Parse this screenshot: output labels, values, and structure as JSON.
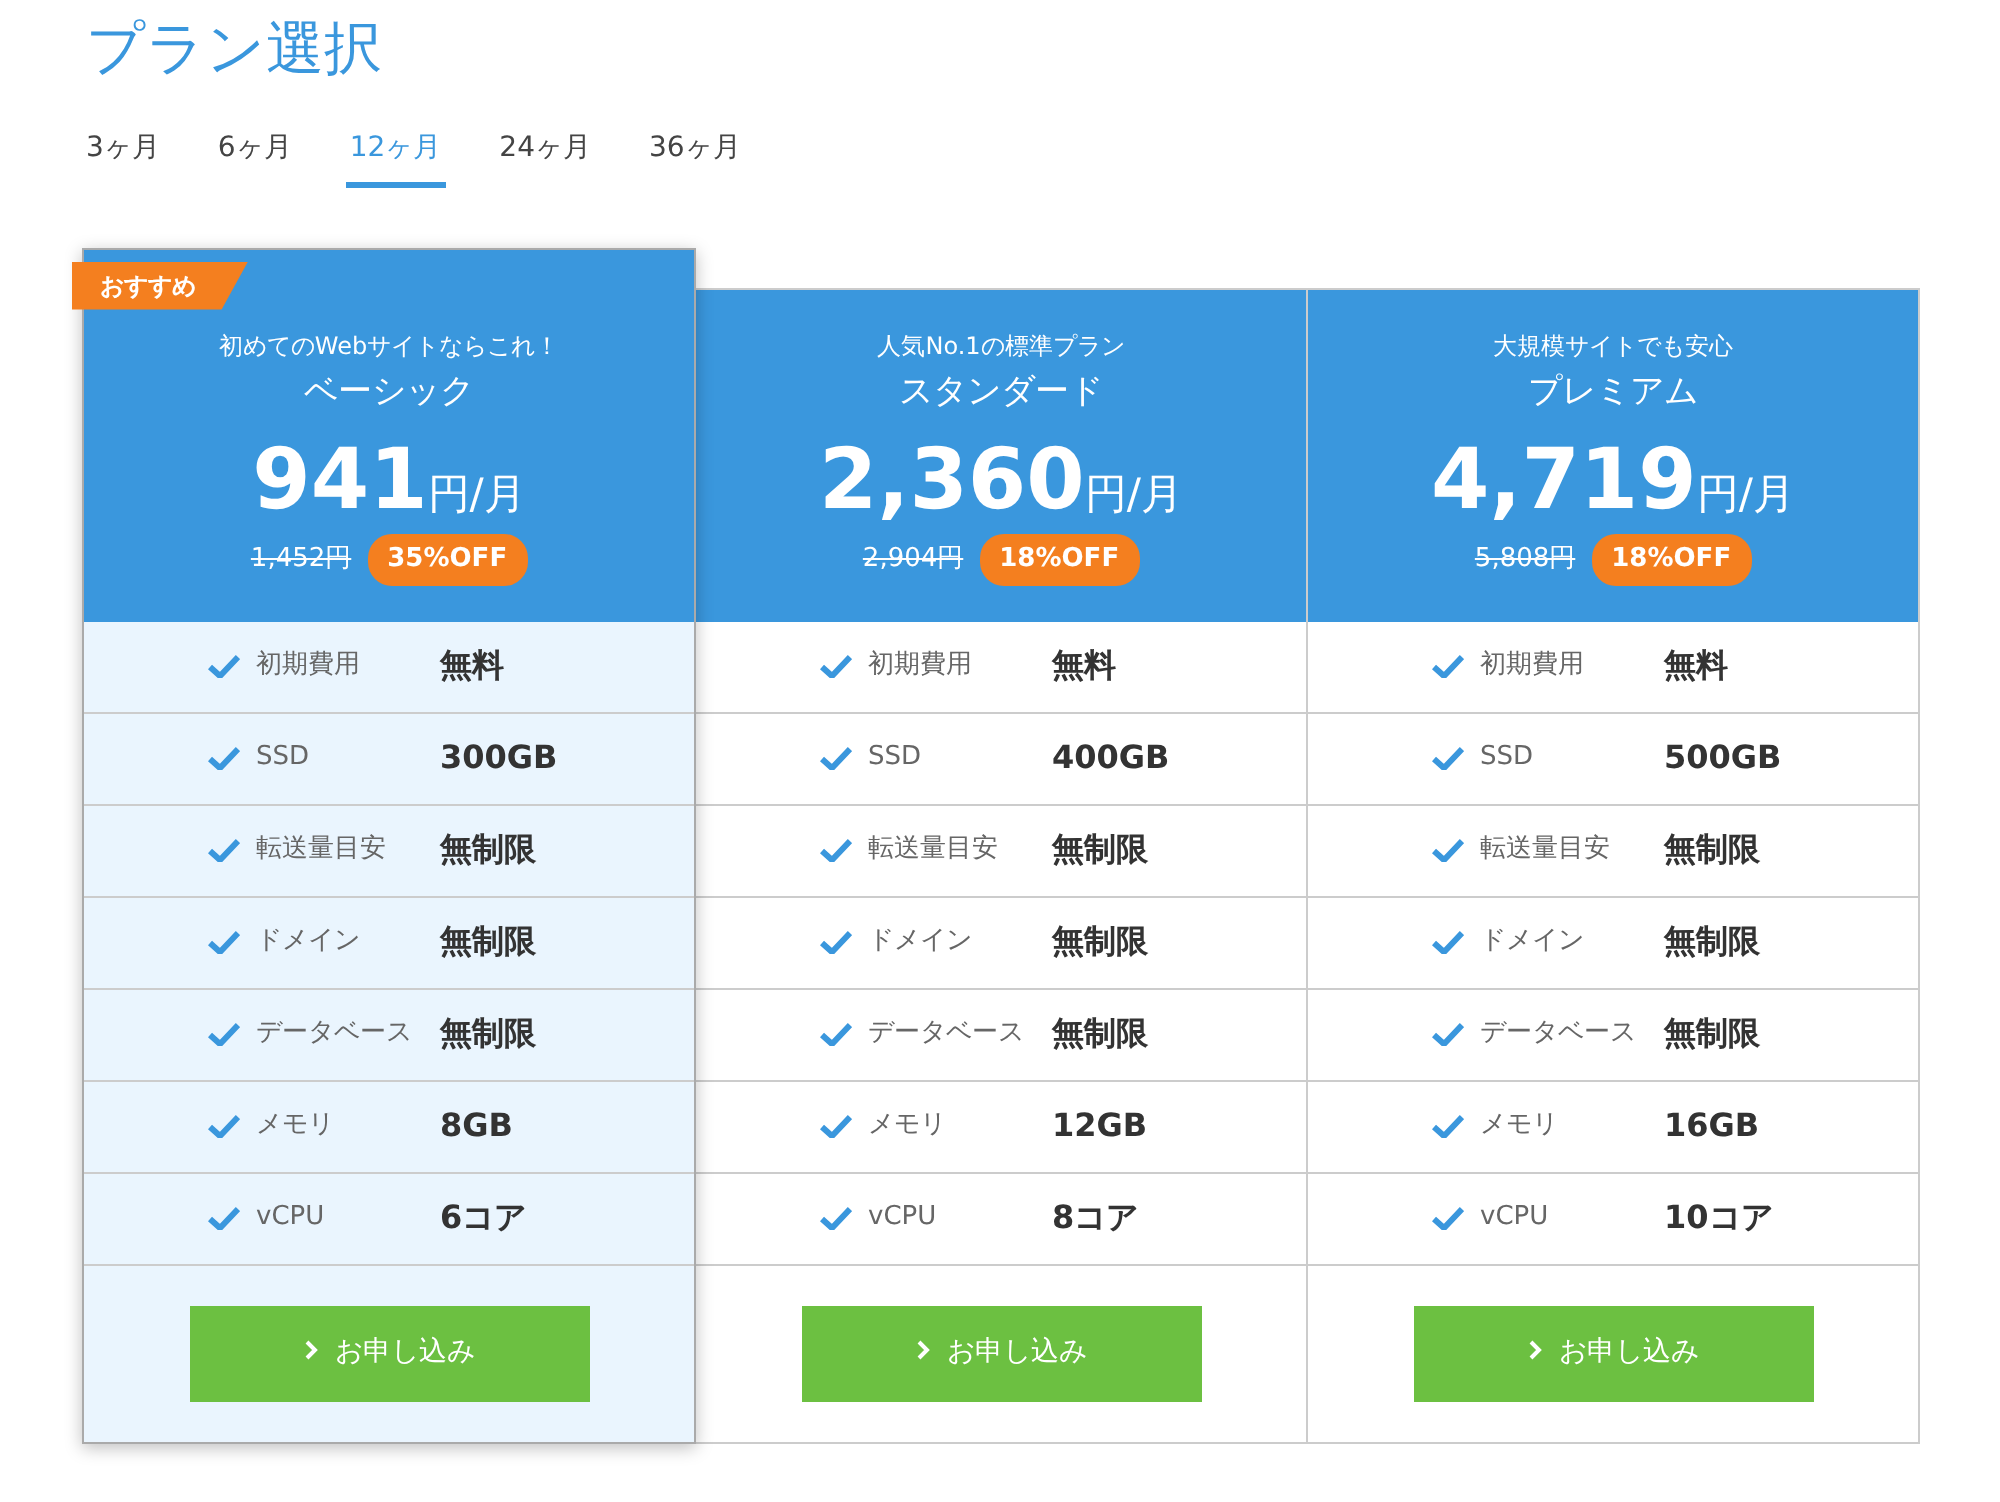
{
  "title": "プラン選択",
  "tabs": [
    {
      "label": "3ヶ月",
      "selected": false
    },
    {
      "label": "6ヶ月",
      "selected": false
    },
    {
      "label": "12ヶ月",
      "selected": true
    },
    {
      "label": "24ヶ月",
      "selected": false
    },
    {
      "label": "36ヶ月",
      "selected": false
    }
  ],
  "plans": [
    {
      "featured": true,
      "badge": "おすすめ",
      "tagline": "初めてのWebサイトならこれ！",
      "name": "ベーシック",
      "price": "941",
      "unit": "円/月",
      "original_price": "1,452円",
      "discount": "35%OFF",
      "features": [
        {
          "label": "初期費用",
          "value": "無料"
        },
        {
          "label": "SSD",
          "value": "300GB"
        },
        {
          "label": "転送量目安",
          "value": "無制限"
        },
        {
          "label": "ドメイン",
          "value": "無制限"
        },
        {
          "label": "データベース",
          "value": "無制限"
        },
        {
          "label": "メモリ",
          "value": "8GB"
        },
        {
          "label": "vCPU",
          "value": "6コア"
        }
      ],
      "button": "お申し込み"
    },
    {
      "featured": false,
      "tagline": "人気No.1の標準プラン",
      "name": "スタンダード",
      "price": "2,360",
      "unit": "円/月",
      "original_price": "2,904円",
      "discount": "18%OFF",
      "features": [
        {
          "label": "初期費用",
          "value": "無料"
        },
        {
          "label": "SSD",
          "value": "400GB"
        },
        {
          "label": "転送量目安",
          "value": "無制限"
        },
        {
          "label": "ドメイン",
          "value": "無制限"
        },
        {
          "label": "データベース",
          "value": "無制限"
        },
        {
          "label": "メモリ",
          "value": "12GB"
        },
        {
          "label": "vCPU",
          "value": "8コア"
        }
      ],
      "button": "お申し込み"
    },
    {
      "featured": false,
      "tagline": "大規模サイトでも安心",
      "name": "プレミアム",
      "price": "4,719",
      "unit": "円/月",
      "original_price": "5,808円",
      "discount": "18%OFF",
      "features": [
        {
          "label": "初期費用",
          "value": "無料"
        },
        {
          "label": "SSD",
          "value": "500GB"
        },
        {
          "label": "転送量目安",
          "value": "無制限"
        },
        {
          "label": "ドメイン",
          "value": "無制限"
        },
        {
          "label": "データベース",
          "value": "無制限"
        },
        {
          "label": "メモリ",
          "value": "16GB"
        },
        {
          "label": "vCPU",
          "value": "10コア"
        }
      ],
      "button": "お申し込み"
    }
  ]
}
